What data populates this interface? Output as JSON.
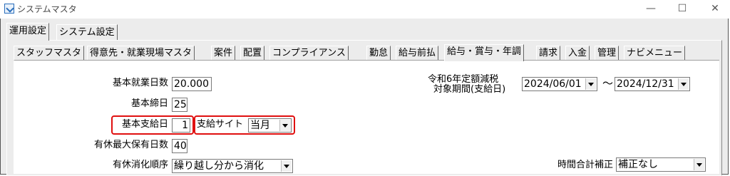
{
  "window": {
    "title": "システムマスタ",
    "minimize": "—",
    "maximize": "☐",
    "close": "✕"
  },
  "outer_tabs": [
    "運用設定",
    "システム設定"
  ],
  "inner_tabs": [
    "スタッフマスタ",
    "得意先・就業現場マスタ",
    "案件",
    "配置",
    "コンプライアンス",
    "勤怠",
    "給与前払",
    "給与・賞与・年調",
    "請求",
    "入金",
    "管理",
    "ナビメニュー"
  ],
  "form": {
    "standard_work_days": {
      "label": "基本就業日数",
      "value": "20.000"
    },
    "standard_closing_day": {
      "label": "基本締日",
      "value": "25"
    },
    "standard_pay_day": {
      "label": "基本支給日",
      "value": "1"
    },
    "pay_site": {
      "label": "支給サイト",
      "value": "当月"
    },
    "max_paid_leave_days": {
      "label": "有休最大保有日数",
      "value": "40"
    },
    "paid_leave_order": {
      "label": "有休消化順序",
      "value": "繰り越し分から消化"
    },
    "tax_period": {
      "label_line1": "令和6年定額減税",
      "label_line2": "対象期間(支給日)",
      "from": "2024/06/01",
      "separator": "〜",
      "to": "2024/12/31"
    },
    "time_total_adjust": {
      "label": "時間合計補正",
      "value": "補正なし"
    }
  }
}
